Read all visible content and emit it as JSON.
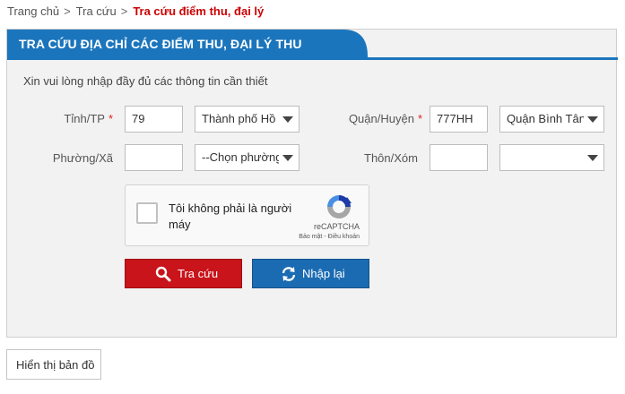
{
  "breadcrumb": {
    "items": [
      "Trang chủ",
      "Tra cứu"
    ],
    "separator": ">",
    "current": "Tra cứu điểm thu, đại lý"
  },
  "panel": {
    "title": "TRA CỨU ĐỊA CHỈ CÁC ĐIỂM THU, ĐẠI LÝ THU",
    "header_color": "#1b75bc",
    "instruction": "Xin vui lòng nhập đầy đủ các thông tin cần thiết"
  },
  "form": {
    "province": {
      "label": "Tỉnh/TP",
      "required_mark": "*",
      "code": "79",
      "selected": "Thành phố Hồ Chí Minh"
    },
    "district": {
      "label": "Quận/Huyện",
      "required_mark": "*",
      "code": "777HH",
      "selected": "Quận Bình Tân"
    },
    "ward": {
      "label": "Phường/Xã",
      "code": "",
      "selected": "--Chọn phường/xã--"
    },
    "hamlet": {
      "label": "Thôn/Xóm",
      "code": "",
      "selected": ""
    }
  },
  "captcha": {
    "label": "Tôi không phải là người máy",
    "brand": "reCAPTCHA",
    "links": "Bảo mật - Điều khoản"
  },
  "buttons": {
    "search": "Tra cứu",
    "reset": "Nhập lại",
    "map": "Hiển thị bản đồ",
    "search_color": "#c8141a",
    "reset_color": "#1b6bb2"
  }
}
